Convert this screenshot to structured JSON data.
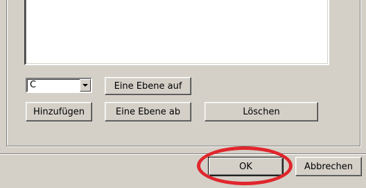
{
  "layer_select": {
    "value": "C"
  },
  "buttons": {
    "layer_up": "Eine Ebene auf",
    "add": "Hinzufügen",
    "layer_down": "Eine Ebene ab",
    "delete": "Löschen",
    "ok": "OK",
    "cancel": "Abbrechen"
  },
  "colors": {
    "highlight_ring": "#e0262c",
    "window_bg": "#d4d0c8"
  }
}
